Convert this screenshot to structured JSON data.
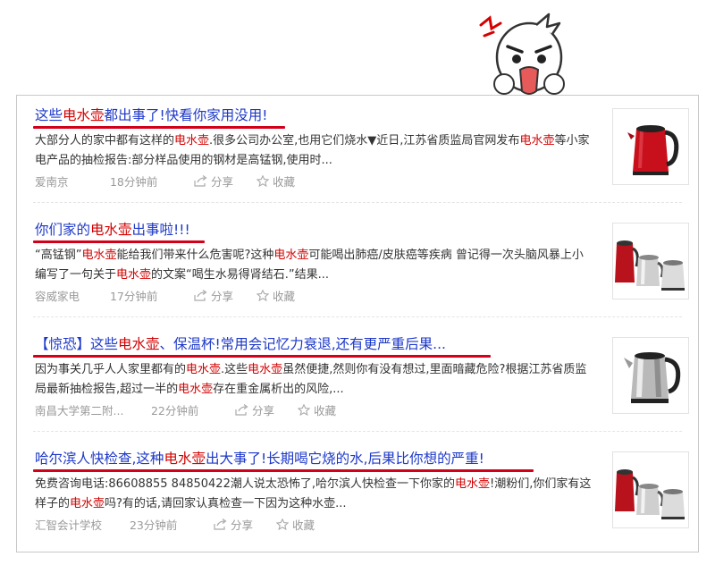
{
  "results": [
    {
      "title_parts": [
        {
          "t": "这些",
          "hl": false
        },
        {
          "t": "电水壶",
          "hl": true
        },
        {
          "t": "都出事了!快看你家用没用!",
          "hl": false
        }
      ],
      "desc_parts": [
        {
          "t": "大部分人的家中都有这样的",
          "hl": false
        },
        {
          "t": "电水壶",
          "hl": true
        },
        {
          "t": ".很多公司办公室,也用它们烧水▼近日,江苏省质监局官网发布",
          "hl": false
        },
        {
          "t": "电水壶",
          "hl": true
        },
        {
          "t": "等小家电产品的抽检报告:部分样品使用的钢材是高锰钢,使用时...",
          "hl": false
        }
      ],
      "source": "爱南京",
      "time": "18分钟前",
      "share_label": "分享",
      "fav_label": "收藏",
      "thumb": "red-kettle"
    },
    {
      "title_parts": [
        {
          "t": "你们家的",
          "hl": false
        },
        {
          "t": "电水壶",
          "hl": true
        },
        {
          "t": "出事啦!!!",
          "hl": false
        }
      ],
      "desc_parts": [
        {
          "t": "“高锰钢”",
          "hl": false
        },
        {
          "t": "电水壶",
          "hl": true
        },
        {
          "t": "能给我们带来什么危害呢?这种",
          "hl": false
        },
        {
          "t": "电水壶",
          "hl": true
        },
        {
          "t": "可能喝出肺癌/皮肤癌等疾病 曾记得一次头脑风暴上小编写了一句关于",
          "hl": false
        },
        {
          "t": "电水壶",
          "hl": true
        },
        {
          "t": "的文案“喝生水易得肾结石.”结果...",
          "hl": false
        }
      ],
      "source": "容威家电",
      "time": "17分钟前",
      "share_label": "分享",
      "fav_label": "收藏",
      "thumb": "kettle-group"
    },
    {
      "title_parts": [
        {
          "t": "【惊恐】这些",
          "hl": false
        },
        {
          "t": "电水壶",
          "hl": true
        },
        {
          "t": "、保温杯!常用会记忆力衰退,还有更严重后果...",
          "hl": false
        }
      ],
      "desc_parts": [
        {
          "t": "因为事关几乎人人家里都有的",
          "hl": false
        },
        {
          "t": "电水壶",
          "hl": true
        },
        {
          "t": ".这些",
          "hl": false
        },
        {
          "t": "电水壶",
          "hl": true
        },
        {
          "t": "虽然便捷,然则你有没有想过,里面暗藏危险?根据江苏省质监局最新抽检报告,超过一半的",
          "hl": false
        },
        {
          "t": "电水壶",
          "hl": true
        },
        {
          "t": "存在重金属析出的风险,...",
          "hl": false
        }
      ],
      "source": "南昌大学第二附...",
      "time": "22分钟前",
      "share_label": "分享",
      "fav_label": "收藏",
      "thumb": "steel-kettle"
    },
    {
      "title_parts": [
        {
          "t": "哈尔滨人快检查,这种",
          "hl": false
        },
        {
          "t": "电水壶",
          "hl": true
        },
        {
          "t": "出大事了!长期喝它烧的水,后果比你想的严重!",
          "hl": false
        }
      ],
      "desc_parts": [
        {
          "t": "免费咨询电话:86608855 84850422潮人说太恐怖了,哈尔滨人快检查一下你家的",
          "hl": false
        },
        {
          "t": "电水壶",
          "hl": true
        },
        {
          "t": "!潮粉们,你们家有这样子的",
          "hl": false
        },
        {
          "t": "电水壶",
          "hl": true
        },
        {
          "t": "吗?有的话,请回家认真检查一下因为这种水壶...",
          "hl": false
        }
      ],
      "source": "汇智会计学校",
      "time": "23分钟前",
      "share_label": "分享",
      "fav_label": "收藏",
      "thumb": "kettle-group"
    }
  ],
  "colors": {
    "title": "#1d38c8",
    "highlight": "#d20000",
    "underline": "#d3001a",
    "meta": "#9a9a9a"
  }
}
